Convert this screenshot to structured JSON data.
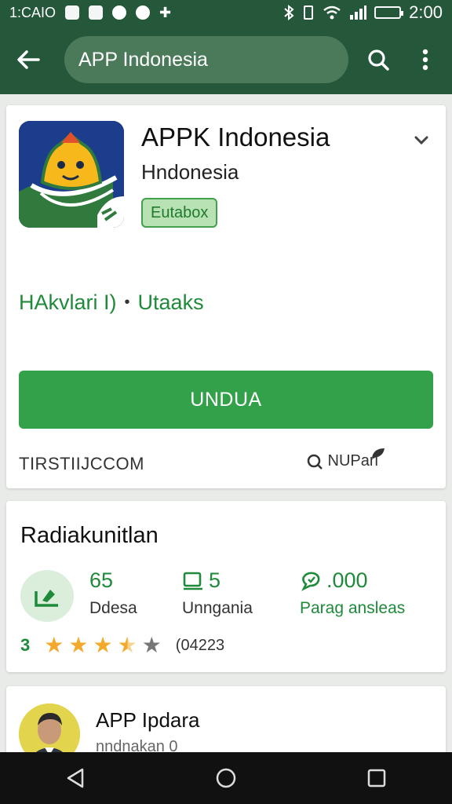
{
  "status_bar": {
    "left_text": "1:CAIO",
    "time": "2:00"
  },
  "app_bar": {
    "search_text": "APP Indonesia"
  },
  "app_card": {
    "title": "APPK Indonesia",
    "developer": "Hndonesia",
    "badge": "Eutabox",
    "tag_left": "HAkvlari I)",
    "tag_separator": "•",
    "tag_right": "Utaaks",
    "install_label": "UNDUA",
    "footer_left": "TIRSTIIJCCOM",
    "footer_right": "NUPari"
  },
  "ratings_card": {
    "title": "Radiakunitlan",
    "stats": [
      {
        "value": "65",
        "label": "Ddesa"
      },
      {
        "value": "5",
        "label": "Unngania"
      },
      {
        "value": ".000",
        "label": "Parag ansleas"
      }
    ],
    "rating_value": "3",
    "stars_filled": 3.5,
    "stars_total": 5,
    "rating_count": "(04223"
  },
  "developer_card": {
    "name": "APP Ipdara",
    "subtitle": "nndnakan 0"
  },
  "colors": {
    "primary_dark": "#25573a",
    "accent_green": "#33a14a",
    "text_green": "#1f8a3a",
    "star": "#f3a92b"
  }
}
